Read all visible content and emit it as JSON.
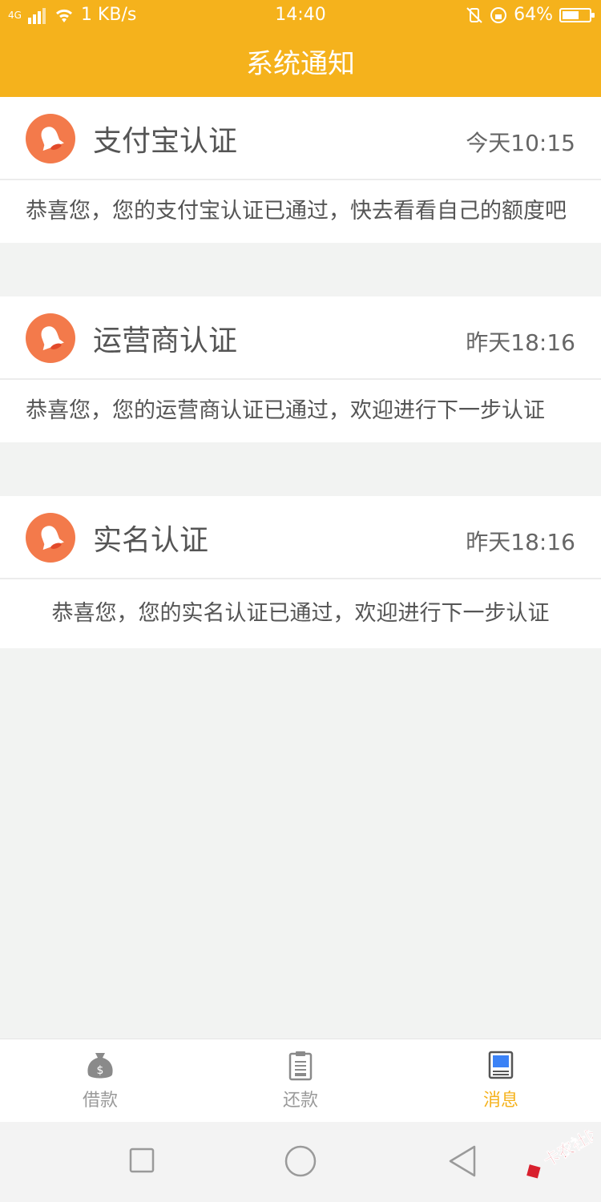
{
  "status": {
    "network": "4G",
    "speed": "1 KB/s",
    "time": "14:40",
    "battery": "64%",
    "battery_level": 0.64
  },
  "header": {
    "title": "系统通知"
  },
  "notifications": [
    {
      "title": "支付宝认证",
      "time": "今天10:15",
      "message": "恭喜您，您的支付宝认证已通过，快去看看自己的额度吧"
    },
    {
      "title": "运营商认证",
      "time": "昨天18:16",
      "message": "恭喜您，您的运营商认证已通过，欢迎进行下一步认证"
    },
    {
      "title": "实名认证",
      "time": "昨天18:16",
      "message": "恭喜您，您的实名认证已通过，欢迎进行下一步认证"
    }
  ],
  "tabbar": {
    "items": [
      {
        "label": "借款",
        "icon": "money-bag-icon"
      },
      {
        "label": "还款",
        "icon": "clipboard-icon"
      },
      {
        "label": "消息",
        "icon": "message-book-icon"
      }
    ],
    "active": 2,
    "active_color": "#f5b21c",
    "inactive_color": "#9a9a9a"
  },
  "watermark": {
    "text": "卡农社区"
  },
  "colors": {
    "primary": "#f5b21c",
    "avatar": "#f37a4b",
    "background": "#f2f3f2",
    "tab_active_icon": "#3b82f6"
  }
}
